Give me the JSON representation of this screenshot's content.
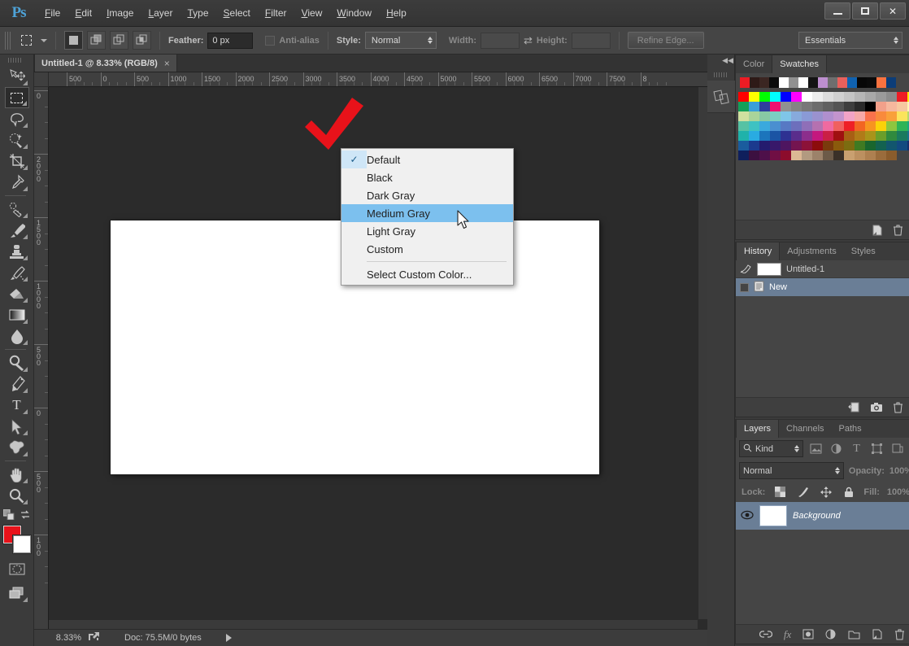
{
  "app": {
    "name": "Ps",
    "logo_icon": "photoshop-logo"
  },
  "titlebar": {
    "menus": [
      "File",
      "Edit",
      "Image",
      "Layer",
      "Type",
      "Select",
      "Filter",
      "View",
      "Window",
      "Help"
    ],
    "window_controls": {
      "minimize": "—",
      "maximize": "□",
      "close": "✕"
    }
  },
  "options_bar": {
    "feather_label": "Feather:",
    "feather_value": "0 px",
    "antialias_label": "Anti-alias",
    "style_label": "Style:",
    "style_value": "Normal",
    "width_label": "Width:",
    "width_value": "",
    "height_label": "Height:",
    "height_value": "",
    "refine_edge_label": "Refine Edge...",
    "workspace_value": "Essentials"
  },
  "toolbox": {
    "tools": [
      {
        "name": "move-tool",
        "glyph": "move"
      },
      {
        "name": "rectangular-marquee-tool",
        "glyph": "marquee",
        "active": true
      },
      {
        "name": "lasso-tool",
        "glyph": "lasso"
      },
      {
        "name": "quick-selection-tool",
        "glyph": "quickselect"
      },
      {
        "name": "crop-tool",
        "glyph": "crop"
      },
      {
        "name": "eyedropper-tool",
        "glyph": "eyedropper"
      },
      {
        "name": "spot-healing-brush-tool",
        "glyph": "healing"
      },
      {
        "name": "brush-tool",
        "glyph": "brush"
      },
      {
        "name": "clone-stamp-tool",
        "glyph": "stamp"
      },
      {
        "name": "history-brush-tool",
        "glyph": "historybrush"
      },
      {
        "name": "eraser-tool",
        "glyph": "eraser"
      },
      {
        "name": "gradient-tool",
        "glyph": "gradient"
      },
      {
        "name": "blur-tool",
        "glyph": "blur"
      },
      {
        "name": "dodge-tool",
        "glyph": "dodge"
      },
      {
        "name": "pen-tool",
        "glyph": "pen"
      },
      {
        "name": "type-tool",
        "glyph": "type"
      },
      {
        "name": "path-selection-tool",
        "glyph": "pathselect"
      },
      {
        "name": "shape-tool",
        "glyph": "shape"
      },
      {
        "name": "hand-tool",
        "glyph": "hand"
      },
      {
        "name": "zoom-tool",
        "glyph": "zoom"
      }
    ],
    "foreground_color": "#e8121a",
    "background_color": "#ffffff"
  },
  "document": {
    "tab_title": "Untitled-1 @ 8.33% (RGB/8)",
    "close_glyph": "×",
    "ruler_h_labels": [
      "500",
      "0",
      "500",
      "1000",
      "1500",
      "2000",
      "2500",
      "3000",
      "3500",
      "4000",
      "4500",
      "5000",
      "5500",
      "6000",
      "6500",
      "7000",
      "7500",
      "8"
    ],
    "ruler_v_labels": [
      "0",
      "2000",
      "1500",
      "1000",
      "500",
      "0",
      "500",
      "100"
    ]
  },
  "statusbar": {
    "zoom": "8.33%",
    "doc_info": "Doc: 75.5M/0 bytes"
  },
  "context_menu": {
    "items": [
      {
        "label": "Default",
        "checked": true,
        "highlighted": false
      },
      {
        "label": "Black",
        "checked": false,
        "highlighted": false
      },
      {
        "label": "Dark Gray",
        "checked": false,
        "highlighted": false
      },
      {
        "label": "Medium Gray",
        "checked": false,
        "highlighted": true
      },
      {
        "label": "Light Gray",
        "checked": false,
        "highlighted": false
      },
      {
        "label": "Custom",
        "checked": false,
        "highlighted": false
      }
    ],
    "footer_item": "Select Custom Color...",
    "check_glyph": "✓",
    "highlight_color": "#7cc0ee"
  },
  "annotation": {
    "shape": "red-checkmark",
    "color": "#e8121a"
  },
  "panels": {
    "color_swatches": {
      "tabs": [
        {
          "label": "Color",
          "active": false
        },
        {
          "label": "Swatches",
          "active": true
        }
      ],
      "recent_colors": [
        "#ed1c24",
        "#2e1a17",
        "#3b2622",
        "#0c0c0c",
        "#ffffff",
        "#919191",
        "#ffffff",
        "#141414",
        "#bd8fcf",
        "#6e6e6e",
        "#e8605c",
        "#1062b0",
        "#070707",
        "#0a0a0a",
        "#f9723f",
        "#0c3d78"
      ],
      "grid_colors": [
        "#ff0000",
        "#ffff00",
        "#00ff00",
        "#00ffff",
        "#0000ff",
        "#ff00ff",
        "#ffffff",
        "#ededed",
        "#dcdcdc",
        "#d0d0d0",
        "#c4c4c4",
        "#b6b6b6",
        "#a8a8a8",
        "#9a9a9a",
        "#8c8c8c",
        "#ee1c25",
        "#ffe800",
        "#14a05a",
        "#3a9fd8",
        "#2f3f9e",
        "#ee1070",
        "#919191",
        "#848484",
        "#787878",
        "#6c6c6c",
        "#606060",
        "#545454",
        "#3e3e3e",
        "#2a2a2a",
        "#000000",
        "#f2a08a",
        "#f6b79d",
        "#f6c8a0",
        "#fdf7b4",
        "#cfe0a0",
        "#a9d49a",
        "#88c9a4",
        "#7ccdc2",
        "#7fc6e8",
        "#87aadc",
        "#8a9ad6",
        "#9a92cf",
        "#b08fce",
        "#c394cd",
        "#f2a3c6",
        "#f6a9a8",
        "#f9724c",
        "#f98a3c",
        "#f9a03a",
        "#fbe45c",
        "#b6d96a",
        "#56c2a4",
        "#3fc2c2",
        "#3aa9dd",
        "#4a8fd0",
        "#5779c4",
        "#6d6fbc",
        "#8f6fb8",
        "#b571b0",
        "#ef6aa0",
        "#f0605e",
        "#ee2026",
        "#f26522",
        "#f79420",
        "#fbd209",
        "#8dc63f",
        "#2fb457",
        "#1ba77e",
        "#1fb2aa",
        "#29abe2",
        "#1c75bc",
        "#1b54a4",
        "#2e3192",
        "#5a2d8c",
        "#8c2e8c",
        "#c4187e",
        "#ca1f45",
        "#a01010",
        "#a85f14",
        "#b07b18",
        "#a8941a",
        "#6a9e2a",
        "#2f8a3e",
        "#1a7a5e",
        "#18718a",
        "#1a5c9e",
        "#1b3a8e",
        "#241b6e",
        "#38186a",
        "#4e1560",
        "#741450",
        "#8c1238",
        "#8c0c0c",
        "#7a3a0c",
        "#8a5a0c",
        "#7c6c10",
        "#3f7a22",
        "#19662e",
        "#136250",
        "#12566e",
        "#124a80",
        "#142f6e",
        "#0f1f5c",
        "#3c1040",
        "#4e104a",
        "#700f44",
        "#8c0c2c",
        "#dcb894",
        "#b29a80",
        "#9c826a",
        "#6c5a48",
        "#3a3028",
        "#c9a070",
        "#bc9060",
        "#ae8050",
        "#9a6c3c",
        "#8a5c2c"
      ]
    },
    "history": {
      "tabs": [
        {
          "label": "History",
          "active": true
        },
        {
          "label": "Adjustments",
          "active": false
        },
        {
          "label": "Styles",
          "active": false
        }
      ],
      "snapshot": "Untitled-1",
      "states": [
        {
          "label": "New",
          "selected": true
        }
      ],
      "footer_icons": [
        "new-document-icon",
        "camera-snapshot-icon",
        "trash-icon"
      ]
    },
    "layers": {
      "tabs": [
        {
          "label": "Layers",
          "active": true
        },
        {
          "label": "Channels",
          "active": false
        },
        {
          "label": "Paths",
          "active": false
        }
      ],
      "filter_label": "Kind",
      "blend_mode": "Normal",
      "opacity_label": "Opacity:",
      "opacity_value": "100%",
      "lock_label": "Lock:",
      "fill_label": "Fill:",
      "fill_value": "100%",
      "items": [
        {
          "name": "Background",
          "locked": true,
          "visible": true
        }
      ],
      "footer_icons": [
        "link-icon",
        "fx-icon",
        "mask-icon",
        "adjustment-icon",
        "folder-icon",
        "new-layer-icon",
        "trash-icon"
      ]
    }
  }
}
